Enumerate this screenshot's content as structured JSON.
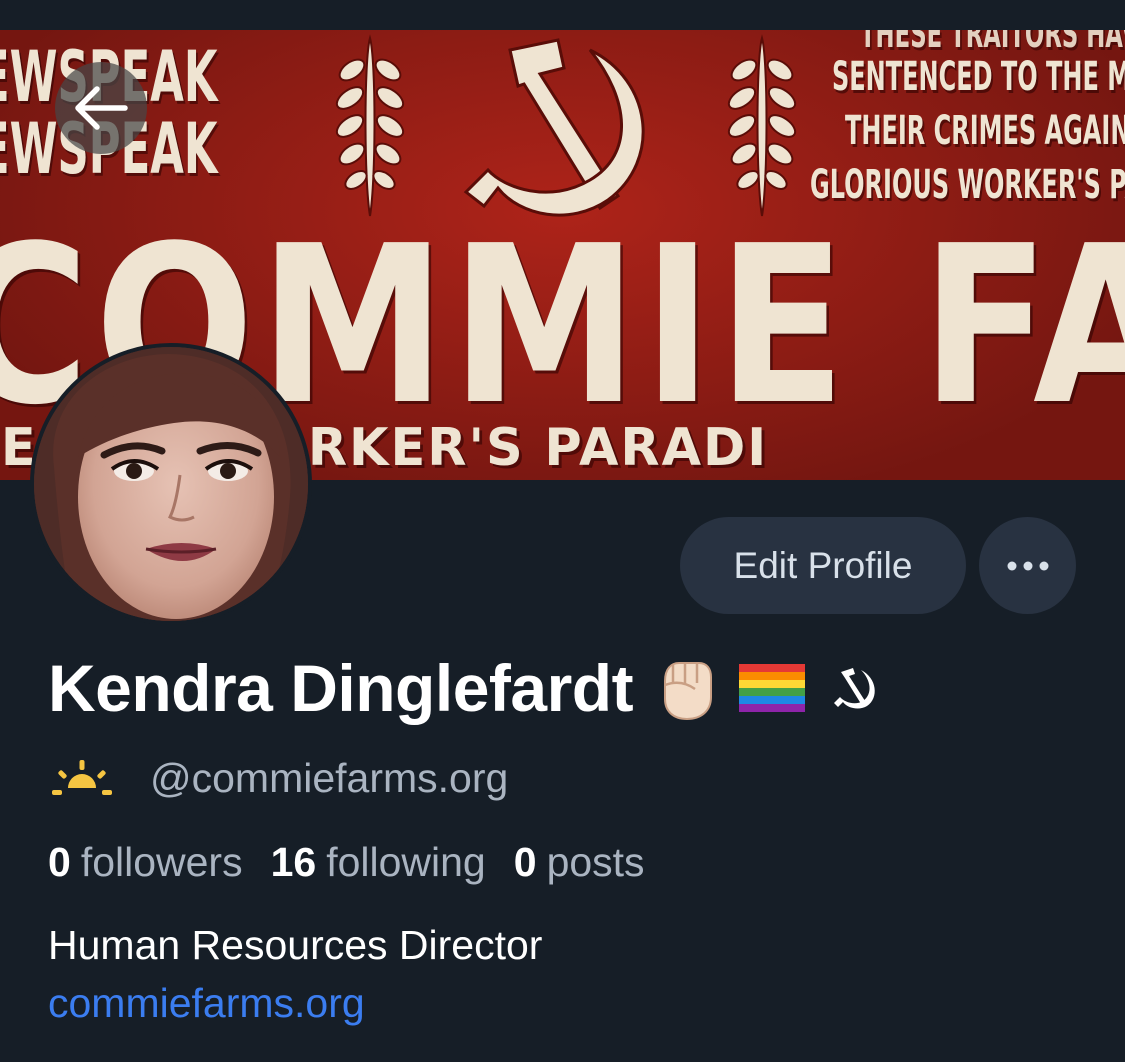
{
  "banner": {
    "line_newspeak_1": "EWSPEAK",
    "line_newspeak_2": "EWSPEAK",
    "line_top_right": "THESE TRAITORS HAV",
    "line_right_1": "SENTENCED TO THE MI",
    "line_right_2": "THEIR CRIMES AGAIN",
    "line_right_3": "GLORIOUS WORKER'S PA",
    "main_title": "COMMIE FARM",
    "bottom_text": "IE   OUS WORKER'S PARADI",
    "background_color": "#9c1e16",
    "text_color": "#efe4d2"
  },
  "navigation": {
    "back_icon": "arrow-left-icon"
  },
  "actions": {
    "edit_profile_label": "Edit Profile",
    "more_icon": "ellipsis-icon"
  },
  "profile": {
    "display_name": "Kendra Dinglefardt",
    "name_emojis": [
      "raised-fist-icon",
      "rainbow-flag-icon",
      "hammer-sickle-icon"
    ],
    "handle_icon": "sunrise-icon",
    "handle": "@commiefarms.org",
    "stats": {
      "followers_count": "0",
      "followers_label": "followers",
      "following_count": "16",
      "following_label": "following",
      "posts_count": "0",
      "posts_label": "posts"
    },
    "bio": "Human Resources Director",
    "website": "commiefarms.org"
  },
  "colors": {
    "background": "#161e27",
    "button_background": "#283241",
    "muted_text": "#aab4c1",
    "link": "#3b7df0"
  }
}
